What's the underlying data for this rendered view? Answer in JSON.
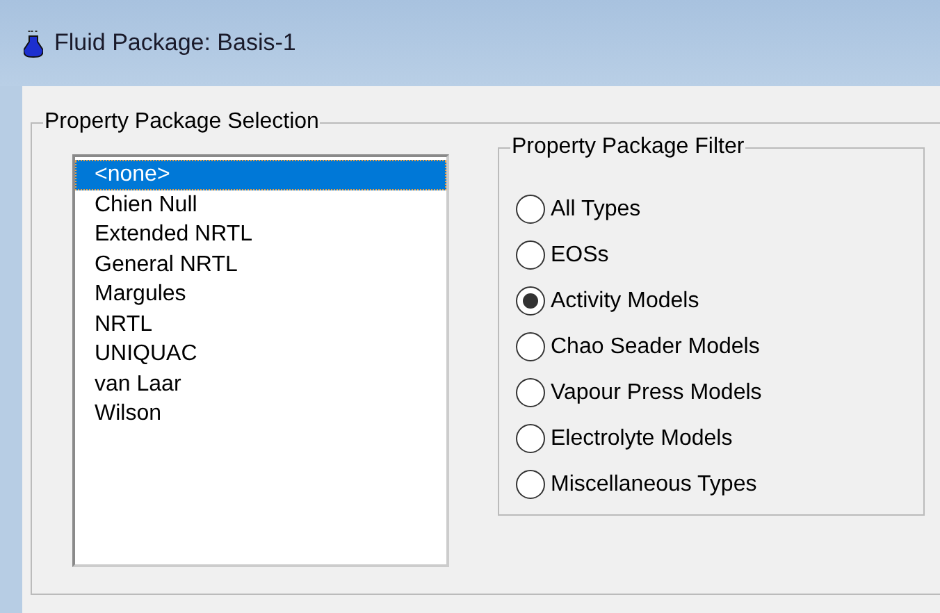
{
  "window": {
    "title": "Fluid Package: Basis-1"
  },
  "selection_group": {
    "title": "Property Package Selection",
    "packages": [
      {
        "label": "<none>",
        "selected": true
      },
      {
        "label": "Chien Null",
        "selected": false
      },
      {
        "label": "Extended NRTL",
        "selected": false
      },
      {
        "label": "General NRTL",
        "selected": false
      },
      {
        "label": "Margules",
        "selected": false
      },
      {
        "label": "NRTL",
        "selected": false
      },
      {
        "label": "UNIQUAC",
        "selected": false
      },
      {
        "label": "van Laar",
        "selected": false
      },
      {
        "label": "Wilson",
        "selected": false
      }
    ]
  },
  "filter_group": {
    "title": "Property Package Filter",
    "options": [
      {
        "label": "All Types",
        "selected": false
      },
      {
        "label": "EOSs",
        "selected": false
      },
      {
        "label": "Activity Models",
        "selected": true
      },
      {
        "label": "Chao Seader Models",
        "selected": false
      },
      {
        "label": "Vapour Press Models",
        "selected": false
      },
      {
        "label": "Electrolyte Models",
        "selected": false
      },
      {
        "label": "Miscellaneous Types",
        "selected": false
      }
    ]
  }
}
